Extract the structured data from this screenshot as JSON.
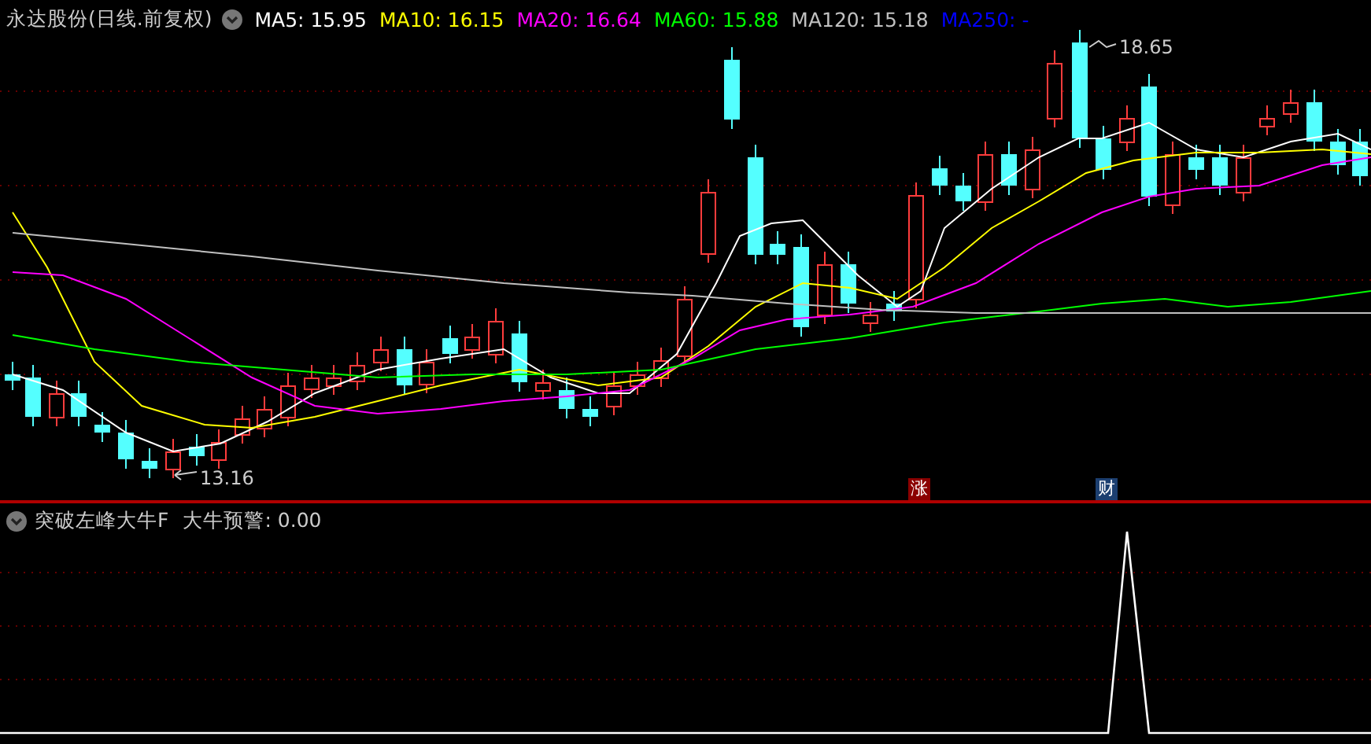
{
  "stock_header": {
    "title": "永达股份(日线.前复权)",
    "ma_legend": [
      {
        "label": "MA5: 15.95",
        "color": "#ffffff"
      },
      {
        "label": "MA10: 16.15",
        "color": "#ffff00"
      },
      {
        "label": "MA20: 16.64",
        "color": "#ff00ff"
      },
      {
        "label": "MA60: 15.88",
        "color": "#00ff00"
      },
      {
        "label": "MA120: 15.18",
        "color": "#c0c0c0"
      },
      {
        "label": "MA250: -",
        "color": "#0000ff"
      }
    ]
  },
  "price_chart": {
    "high_label": "18.65",
    "low_label": "13.16",
    "markers": [
      {
        "text": "涨",
        "color": "#8b0000"
      },
      {
        "text": "财",
        "color": "#1c3f70"
      }
    ]
  },
  "indicator": {
    "title": "突破左峰大牛F",
    "reading": "大牛预警: 0.00"
  }
}
